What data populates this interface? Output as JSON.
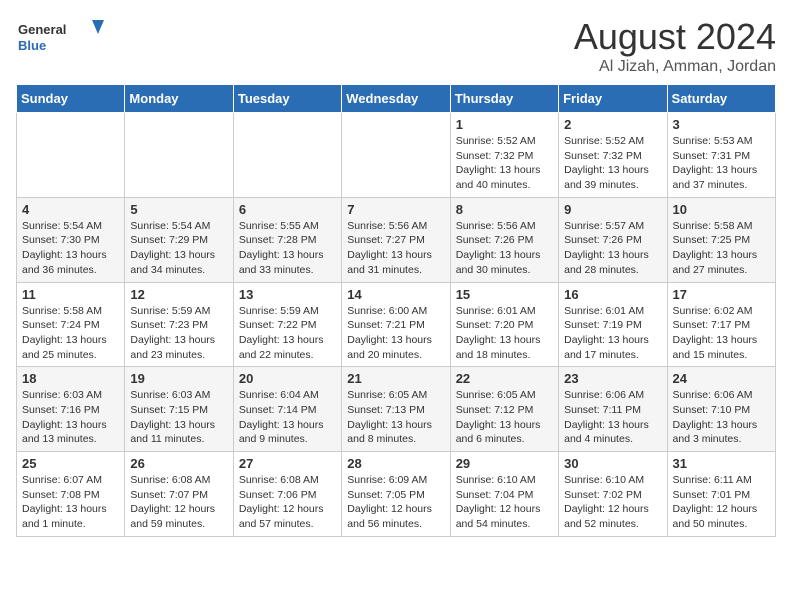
{
  "header": {
    "logo_line1": "General",
    "logo_line2": "Blue",
    "month_year": "August 2024",
    "location": "Al Jizah, Amman, Jordan"
  },
  "days_of_week": [
    "Sunday",
    "Monday",
    "Tuesday",
    "Wednesday",
    "Thursday",
    "Friday",
    "Saturday"
  ],
  "weeks": [
    [
      {
        "day": "",
        "info": ""
      },
      {
        "day": "",
        "info": ""
      },
      {
        "day": "",
        "info": ""
      },
      {
        "day": "",
        "info": ""
      },
      {
        "day": "1",
        "info": "Sunrise: 5:52 AM\nSunset: 7:32 PM\nDaylight: 13 hours\nand 40 minutes."
      },
      {
        "day": "2",
        "info": "Sunrise: 5:52 AM\nSunset: 7:32 PM\nDaylight: 13 hours\nand 39 minutes."
      },
      {
        "day": "3",
        "info": "Sunrise: 5:53 AM\nSunset: 7:31 PM\nDaylight: 13 hours\nand 37 minutes."
      }
    ],
    [
      {
        "day": "4",
        "info": "Sunrise: 5:54 AM\nSunset: 7:30 PM\nDaylight: 13 hours\nand 36 minutes."
      },
      {
        "day": "5",
        "info": "Sunrise: 5:54 AM\nSunset: 7:29 PM\nDaylight: 13 hours\nand 34 minutes."
      },
      {
        "day": "6",
        "info": "Sunrise: 5:55 AM\nSunset: 7:28 PM\nDaylight: 13 hours\nand 33 minutes."
      },
      {
        "day": "7",
        "info": "Sunrise: 5:56 AM\nSunset: 7:27 PM\nDaylight: 13 hours\nand 31 minutes."
      },
      {
        "day": "8",
        "info": "Sunrise: 5:56 AM\nSunset: 7:26 PM\nDaylight: 13 hours\nand 30 minutes."
      },
      {
        "day": "9",
        "info": "Sunrise: 5:57 AM\nSunset: 7:26 PM\nDaylight: 13 hours\nand 28 minutes."
      },
      {
        "day": "10",
        "info": "Sunrise: 5:58 AM\nSunset: 7:25 PM\nDaylight: 13 hours\nand 27 minutes."
      }
    ],
    [
      {
        "day": "11",
        "info": "Sunrise: 5:58 AM\nSunset: 7:24 PM\nDaylight: 13 hours\nand 25 minutes."
      },
      {
        "day": "12",
        "info": "Sunrise: 5:59 AM\nSunset: 7:23 PM\nDaylight: 13 hours\nand 23 minutes."
      },
      {
        "day": "13",
        "info": "Sunrise: 5:59 AM\nSunset: 7:22 PM\nDaylight: 13 hours\nand 22 minutes."
      },
      {
        "day": "14",
        "info": "Sunrise: 6:00 AM\nSunset: 7:21 PM\nDaylight: 13 hours\nand 20 minutes."
      },
      {
        "day": "15",
        "info": "Sunrise: 6:01 AM\nSunset: 7:20 PM\nDaylight: 13 hours\nand 18 minutes."
      },
      {
        "day": "16",
        "info": "Sunrise: 6:01 AM\nSunset: 7:19 PM\nDaylight: 13 hours\nand 17 minutes."
      },
      {
        "day": "17",
        "info": "Sunrise: 6:02 AM\nSunset: 7:17 PM\nDaylight: 13 hours\nand 15 minutes."
      }
    ],
    [
      {
        "day": "18",
        "info": "Sunrise: 6:03 AM\nSunset: 7:16 PM\nDaylight: 13 hours\nand 13 minutes."
      },
      {
        "day": "19",
        "info": "Sunrise: 6:03 AM\nSunset: 7:15 PM\nDaylight: 13 hours\nand 11 minutes."
      },
      {
        "day": "20",
        "info": "Sunrise: 6:04 AM\nSunset: 7:14 PM\nDaylight: 13 hours\nand 9 minutes."
      },
      {
        "day": "21",
        "info": "Sunrise: 6:05 AM\nSunset: 7:13 PM\nDaylight: 13 hours\nand 8 minutes."
      },
      {
        "day": "22",
        "info": "Sunrise: 6:05 AM\nSunset: 7:12 PM\nDaylight: 13 hours\nand 6 minutes."
      },
      {
        "day": "23",
        "info": "Sunrise: 6:06 AM\nSunset: 7:11 PM\nDaylight: 13 hours\nand 4 minutes."
      },
      {
        "day": "24",
        "info": "Sunrise: 6:06 AM\nSunset: 7:10 PM\nDaylight: 13 hours\nand 3 minutes."
      }
    ],
    [
      {
        "day": "25",
        "info": "Sunrise: 6:07 AM\nSunset: 7:08 PM\nDaylight: 13 hours\nand 1 minute."
      },
      {
        "day": "26",
        "info": "Sunrise: 6:08 AM\nSunset: 7:07 PM\nDaylight: 12 hours\nand 59 minutes."
      },
      {
        "day": "27",
        "info": "Sunrise: 6:08 AM\nSunset: 7:06 PM\nDaylight: 12 hours\nand 57 minutes."
      },
      {
        "day": "28",
        "info": "Sunrise: 6:09 AM\nSunset: 7:05 PM\nDaylight: 12 hours\nand 56 minutes."
      },
      {
        "day": "29",
        "info": "Sunrise: 6:10 AM\nSunset: 7:04 PM\nDaylight: 12 hours\nand 54 minutes."
      },
      {
        "day": "30",
        "info": "Sunrise: 6:10 AM\nSunset: 7:02 PM\nDaylight: 12 hours\nand 52 minutes."
      },
      {
        "day": "31",
        "info": "Sunrise: 6:11 AM\nSunset: 7:01 PM\nDaylight: 12 hours\nand 50 minutes."
      }
    ]
  ]
}
